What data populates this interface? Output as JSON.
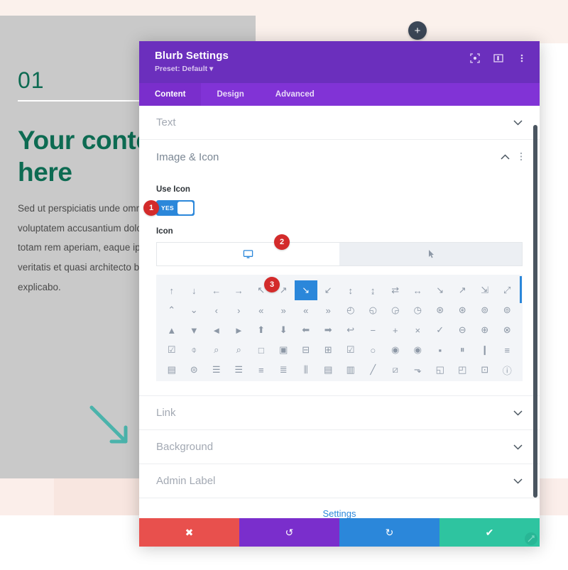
{
  "background_page": {
    "add_button_icon": "plus-icon",
    "number_label": "01",
    "heading": "Your content goes here",
    "paragraph": "Sed ut perspiciatis unde omnis iste natus error sit voluptatem accusantium doloremque laudantium, totam rem aperiam, eaque ipsa quae ab illo inventore veritatis et quasi architecto beatae vitae dicta sunt explicabo.",
    "heading_color": "#0d6b52",
    "panel_color": "#c9c9c9",
    "accent_arrow_color": "#4bb3ab"
  },
  "modal": {
    "title": "Blurb Settings",
    "preset": "Preset: Default",
    "preset_caret": "▾",
    "header_color": "#6b2fbd",
    "tabs_bar_color": "#8133d6",
    "header_icons": [
      {
        "name": "focus-target-icon",
        "glyph": "⬚"
      },
      {
        "name": "layout-columns-icon",
        "glyph": "▥"
      },
      {
        "name": "kebab-menu-icon",
        "glyph": "⋮"
      }
    ],
    "tabs": [
      {
        "label": "Content",
        "active": true
      },
      {
        "label": "Design",
        "active": false
      },
      {
        "label": "Advanced",
        "active": false
      }
    ],
    "sections": [
      {
        "label": "Text",
        "open": false,
        "chevron": "⌄"
      },
      {
        "label": "Image & Icon",
        "open": true,
        "chevron": "⌃"
      },
      {
        "label": "Link",
        "open": false,
        "chevron": "⌄"
      },
      {
        "label": "Background",
        "open": false,
        "chevron": "⌄"
      },
      {
        "label": "Admin Label",
        "open": false,
        "chevron": "⌄"
      }
    ],
    "image_icon_section": {
      "use_icon_label": "Use Icon",
      "toggle_value": "YES",
      "toggle_color": "#2b87da",
      "icon_field_label": "Icon",
      "selected_icon_glyph": "⬜",
      "picker_cursor_icon": "mouse-pointer-icon"
    },
    "icon_grid": {
      "selected_index": 6,
      "selected_color": "#2b87da",
      "glyphs": [
        "↑",
        "↓",
        "←",
        "→",
        "↖",
        "↗",
        "↘",
        "↙",
        "↕",
        "↨",
        "⇄",
        "↔",
        "↘",
        "↗",
        "⇲",
        "⤢",
        "⌃",
        "⌄",
        "‹",
        "›",
        "«",
        "»",
        "«",
        "»",
        "◴",
        "◵",
        "◶",
        "◷",
        "⊛",
        "⊛",
        "⊚",
        "⊚",
        "▲",
        "▼",
        "◄",
        "►",
        "⬆",
        "⬇",
        "⬅",
        "➡",
        "↩",
        "−",
        "+",
        "×",
        "✓",
        "⊖",
        "⊕",
        "⊗",
        "☑",
        "⌽",
        "⌕",
        "⌕",
        "□",
        "▣",
        "⊟",
        "⊞",
        "☑",
        "○",
        "◉",
        "◉",
        "▪",
        "⏸",
        "❙",
        "≡",
        "▤",
        "⊜",
        "☰",
        "☰",
        "≡",
        "≣",
        "⫼",
        "▤",
        "▥",
        "╱",
        "⧄",
        "⬎",
        "◱",
        "◰",
        "⊡",
        "ⓘ",
        "ⓘ",
        "ⓘ",
        "⚠",
        "⍰",
        "?"
      ]
    },
    "footer_buttons": [
      {
        "name": "cancel-button",
        "icon": "x-icon",
        "glyph": "✖",
        "color": "#e8504d"
      },
      {
        "name": "undo-button",
        "icon": "undo-icon",
        "glyph": "↺",
        "color": "#7a2ecc"
      },
      {
        "name": "redo-button",
        "icon": "redo-icon",
        "glyph": "↻",
        "color": "#2b87da"
      },
      {
        "name": "save-button",
        "icon": "check-icon",
        "glyph": "✔",
        "color": "#2ec4a0"
      }
    ],
    "bottom_hint": "Settings"
  },
  "callouts": [
    {
      "number": "1",
      "target": "use-icon-toggle"
    },
    {
      "number": "2",
      "target": "icon-picker"
    },
    {
      "number": "3",
      "target": "icon-grid-selected"
    }
  ]
}
